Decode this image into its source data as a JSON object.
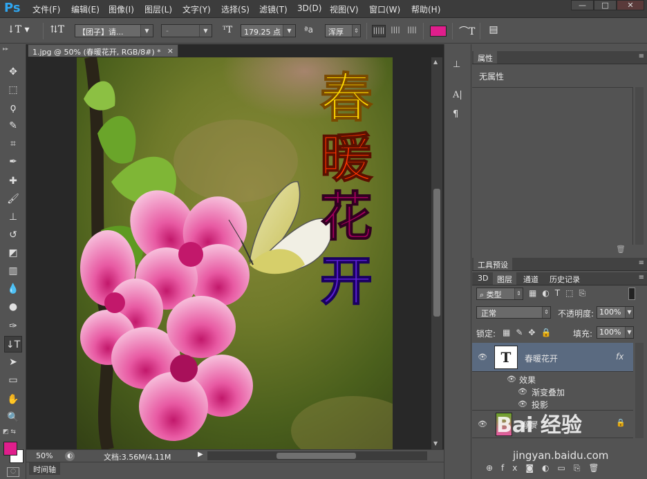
{
  "app": {
    "logo": "Ps",
    "menu": [
      "文件(F)",
      "编辑(E)",
      "图像(I)",
      "图层(L)",
      "文字(Y)",
      "选择(S)",
      "滤镜(T)",
      "3D(D)",
      "视图(V)",
      "窗口(W)",
      "帮助(H)"
    ],
    "window_controls": {
      "minimize": "—",
      "maximize": "□",
      "close": "✕"
    }
  },
  "options": {
    "font_family": "【团子】请...",
    "font_style": "-",
    "font_size": "179.25 点",
    "aa_label": "ªa",
    "antialias": "浑厚",
    "text_color": "#e01e8c"
  },
  "document": {
    "tab_title": "1.jpg @ 50% (春暖花开, RGB/8#) *",
    "tab_close": "×",
    "text_chars": [
      "春",
      "暖",
      "花",
      "开"
    ],
    "char_colors": [
      "#ffd700",
      "#ff3300",
      "#a0005a",
      "#5a20d0"
    ],
    "zoom": "50%",
    "doc_info": "文档:3.56M/4.11M"
  },
  "timeline": {
    "label": "时间轴"
  },
  "properties": {
    "tab": "属性",
    "content": "无属性"
  },
  "tool_presets": {
    "tab": "工具预设"
  },
  "layers_panel": {
    "tabs": [
      "3D",
      "图层",
      "通道",
      "历史记录"
    ],
    "filter_type": "类型",
    "blend_mode": "正常",
    "opacity_label": "不透明度:",
    "opacity_value": "100%",
    "lock_label": "锁定:",
    "fill_label": "填充:",
    "fill_value": "100%",
    "layers": [
      {
        "name": "春暖花开",
        "thumb": "T",
        "fx": "fx"
      },
      {
        "name": "背景"
      }
    ],
    "effects_label": "效果",
    "effects": [
      "渐变叠加",
      "投影"
    ]
  },
  "watermark": {
    "brand": "Bai 经验",
    "url": "jingyan.baidu.com"
  }
}
